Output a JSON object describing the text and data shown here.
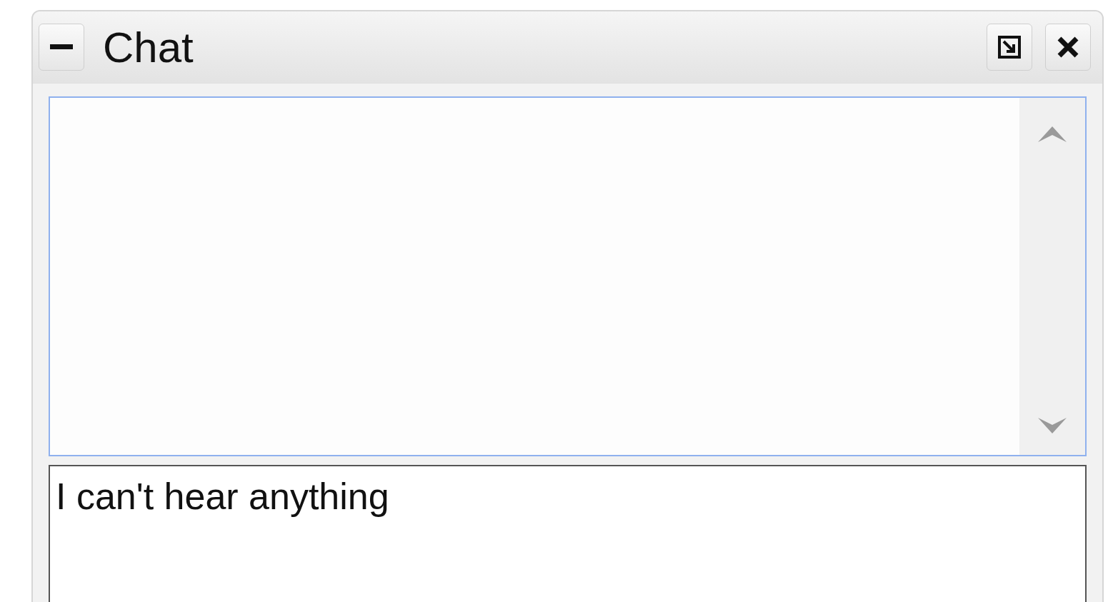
{
  "window": {
    "title": "Chat"
  },
  "input": {
    "value": "I can't hear anything"
  }
}
